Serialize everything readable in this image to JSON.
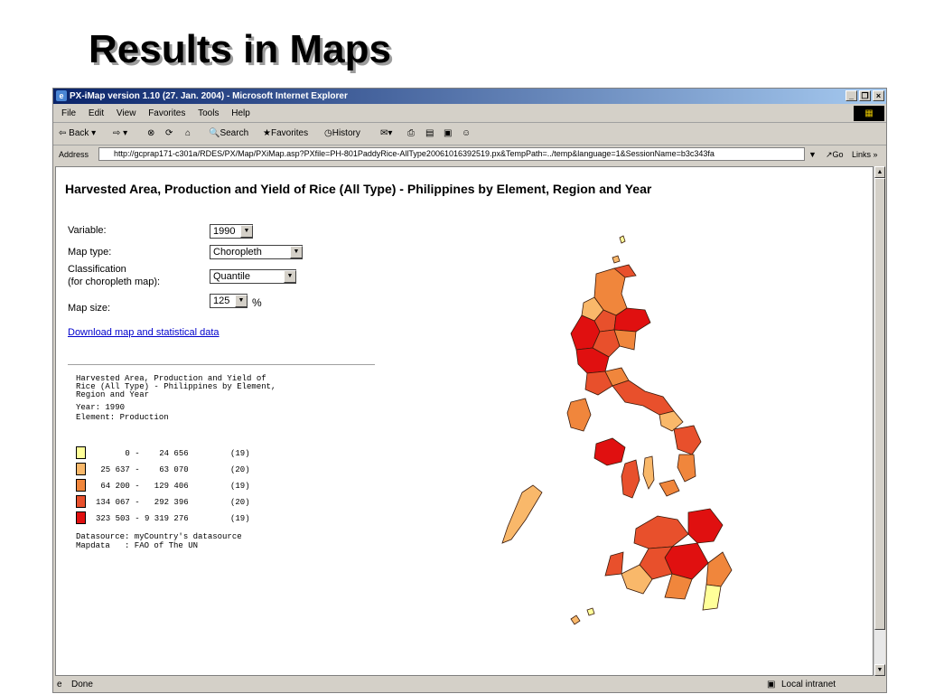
{
  "slide_title": "Results in Maps",
  "window": {
    "title": "PX-iMap version 1.10 (27. Jan. 2004) - Microsoft Internet Explorer",
    "minimize": "_",
    "restore": "❐",
    "close": "×"
  },
  "menu": [
    "File",
    "Edit",
    "View",
    "Favorites",
    "Tools",
    "Help"
  ],
  "toolbar": {
    "back": "Back",
    "search": "Search",
    "favorites": "Favorites",
    "history": "History"
  },
  "address": {
    "label": "Address",
    "url": "http://gcprap171-c301a/RDES/PX/Map/PXiMap.asp?PXfile=PH-801PaddyRice-AllType20061016392519.px&TempPath=../temp&language=1&SessionName=b3c343fa",
    "go": "Go",
    "links": "Links"
  },
  "page": {
    "heading": "Harvested Area, Production and Yield of Rice (All Type) - Philippines by Element, Region and Year",
    "variable_label": "Variable:",
    "variable_value": "1990",
    "maptype_label": "Map type:",
    "maptype_value": "Choropleth",
    "classification_label_1": "Classification",
    "classification_label_2": "(for choropleth map):",
    "classification_value": "Quantile",
    "mapsize_label": "Map size:",
    "mapsize_value": "125",
    "mapsize_unit": "%",
    "download_link": "Download map and statistical data"
  },
  "legend": {
    "title_lines": [
      "Harvested Area, Production and Yield of",
      "Rice (All Type) - Philippines by Element,",
      "Region and Year"
    ],
    "year_line": "Year: 1990",
    "element_line": "Element: Production",
    "classes": [
      {
        "range": "      0 -    24 656",
        "count": "(19)",
        "color": "#ffff99"
      },
      {
        "range": " 25 637 -    63 070",
        "count": "(20)",
        "color": "#f9b86a"
      },
      {
        "range": " 64 200 -   129 406",
        "count": "(19)",
        "color": "#f0863c"
      },
      {
        "range": "134 067 -   292 396",
        "count": "(20)",
        "color": "#e8502c"
      },
      {
        "range": "323 503 - 9 319 276",
        "count": "(19)",
        "color": "#e01010"
      }
    ],
    "datasource_line": "Datasource: myCountry's datasource",
    "mapdata_line": "Mapdata   : FAO of The UN"
  },
  "status": {
    "left": "Done",
    "zone": "Local intranet"
  }
}
